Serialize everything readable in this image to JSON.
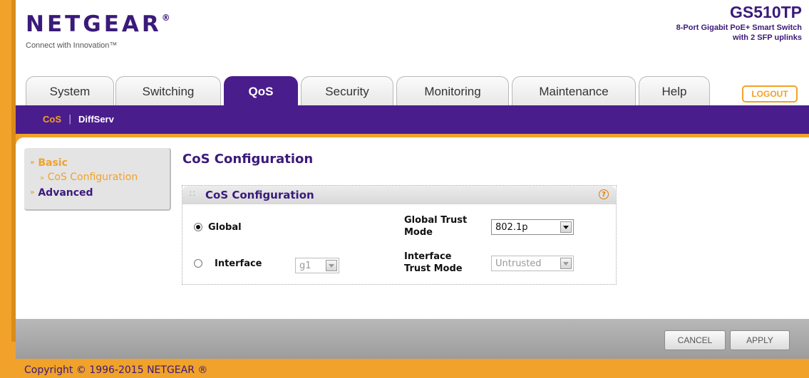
{
  "brand": {
    "logo": "NETGEAR",
    "logo_mark": "®",
    "tagline": "Connect with Innovation™",
    "model": "GS510TP",
    "model_desc_line1": "8-Port Gigabit PoE+ Smart Switch",
    "model_desc_line2": "with 2 SFP uplinks"
  },
  "tabs": [
    {
      "label": "System"
    },
    {
      "label": "Switching"
    },
    {
      "label": "QoS",
      "active": true
    },
    {
      "label": "Security"
    },
    {
      "label": "Monitoring"
    },
    {
      "label": "Maintenance"
    },
    {
      "label": "Help"
    }
  ],
  "logout_label": "LOGOUT",
  "subnav": {
    "items": [
      "CoS",
      "DiffServ"
    ],
    "separator": "|"
  },
  "sidebar": {
    "basic": "Basic",
    "basic_marker": "»",
    "cos_config": "CoS Configuration",
    "cos_marker": "»",
    "advanced": "Advanced",
    "advanced_marker": "»"
  },
  "page_title": "CoS Configuration",
  "panel": {
    "title": "CoS Configuration",
    "help_icon": "?",
    "global_label": "Global",
    "interface_label": "Interface",
    "interface_value": "g1",
    "global_trust_mode_line1": "Global Trust",
    "global_trust_mode_line2": "Mode",
    "global_trust_mode_value": "802.1p",
    "interface_trust_mode_line1": "Interface",
    "interface_trust_mode_line2": "Trust Mode",
    "interface_trust_mode_value": "Untrusted"
  },
  "buttons": {
    "cancel": "CANCEL",
    "apply": "APPLY"
  },
  "copyright": "Copyright © 1996-2015 NETGEAR ®",
  "colors": {
    "brand_purple": "#4a1d8c",
    "accent_orange": "#f0a22a"
  }
}
